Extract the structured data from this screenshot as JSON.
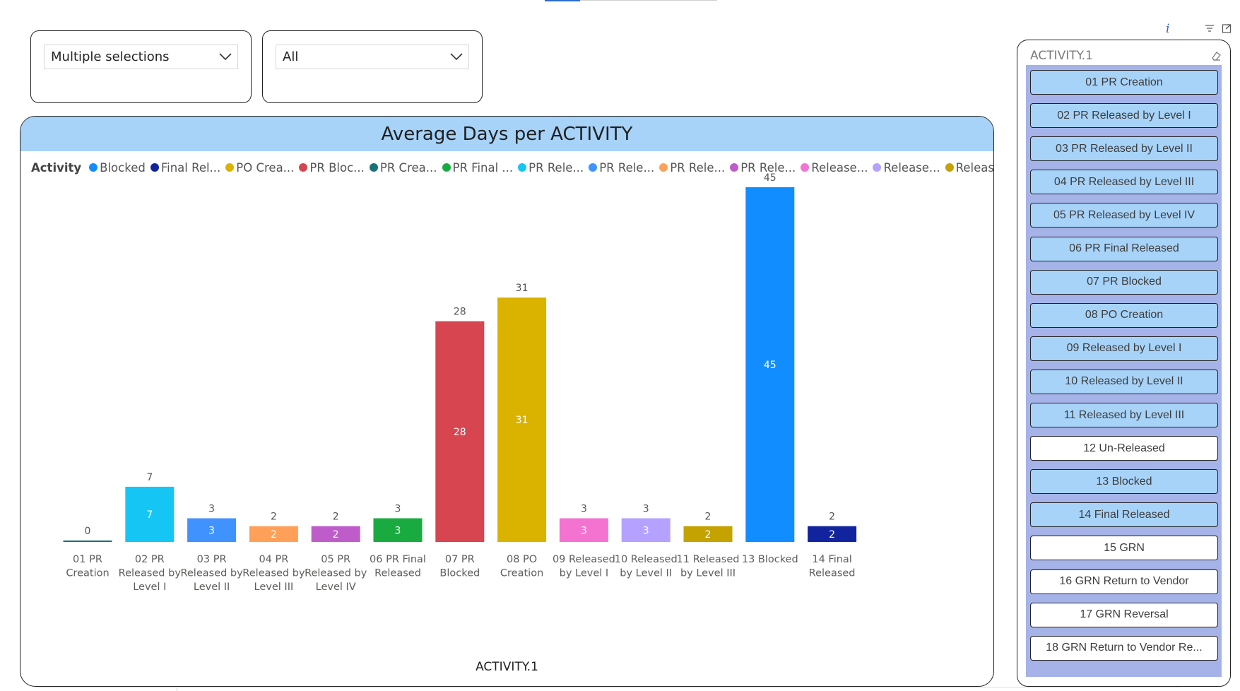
{
  "slicers": [
    {
      "value": "Multiple selections"
    },
    {
      "value": "All"
    }
  ],
  "chart_data": {
    "type": "bar",
    "title": "Average Days per ACTIVITY",
    "xlabel": "ACTIVITY.1",
    "ylabel": "",
    "legend_title": "Activity",
    "legend_placement": "top-left",
    "grid": false,
    "legend": [
      {
        "label": "Blocked",
        "color": "#118dff"
      },
      {
        "label": "Final Rel...",
        "color": "#12239e"
      },
      {
        "label": "PO Crea...",
        "color": "#d9b300"
      },
      {
        "label": "PR Bloc...",
        "color": "#d64550"
      },
      {
        "label": "PR Crea...",
        "color": "#197278"
      },
      {
        "label": "PR Final ...",
        "color": "#1aab40"
      },
      {
        "label": "PR Rele...",
        "color": "#15c6f4"
      },
      {
        "label": "PR Rele...",
        "color": "#4092ff"
      },
      {
        "label": "PR Rele...",
        "color": "#ffa058"
      },
      {
        "label": "PR Rele...",
        "color": "#be5dc9"
      },
      {
        "label": "Release...",
        "color": "#f472d0"
      },
      {
        "label": "Release...",
        "color": "#b5a1ff"
      },
      {
        "label": "Release...",
        "color": "#c4a200"
      }
    ],
    "categories": [
      [
        "01 PR",
        "Creation"
      ],
      [
        "02 PR",
        "Released by",
        "Level I"
      ],
      [
        "03 PR",
        "Released by",
        "Level II"
      ],
      [
        "04 PR",
        "Released by",
        "Level III"
      ],
      [
        "05 PR",
        "Released by",
        "Level IV"
      ],
      [
        "06 PR Final",
        "Released"
      ],
      [
        "07 PR",
        "Blocked"
      ],
      [
        "08 PO",
        "Creation"
      ],
      [
        "09 Released",
        "by Level I"
      ],
      [
        "10 Released",
        "by Level II"
      ],
      [
        "11 Released",
        "by Level III"
      ],
      [
        "13 Blocked"
      ],
      [
        "14 Final",
        "Released"
      ]
    ],
    "values": [
      0,
      7,
      3,
      2,
      2,
      3,
      28,
      31,
      3,
      3,
      2,
      45,
      2
    ],
    "colors": [
      "#197278",
      "#15c6f4",
      "#4092ff",
      "#ffa058",
      "#be5dc9",
      "#1aab40",
      "#d64550",
      "#d9b300",
      "#f472d0",
      "#b5a1ff",
      "#c4a200",
      "#118dff",
      "#12239e"
    ],
    "ylim": [
      0,
      45
    ]
  },
  "activity_slicer": {
    "header": "ACTIVITY.1",
    "items": [
      {
        "label": "01 PR Creation",
        "selected": true
      },
      {
        "label": "02 PR Released by Level I",
        "selected": true
      },
      {
        "label": "03 PR Released by Level II",
        "selected": true
      },
      {
        "label": "04 PR Released by Level III",
        "selected": true
      },
      {
        "label": "05 PR Released by Level IV",
        "selected": true
      },
      {
        "label": "06 PR Final Released",
        "selected": true
      },
      {
        "label": "07 PR Blocked",
        "selected": true
      },
      {
        "label": "08 PO Creation",
        "selected": true
      },
      {
        "label": "09 Released by Level I",
        "selected": true
      },
      {
        "label": "10 Released by Level II",
        "selected": true
      },
      {
        "label": "11 Released by Level III",
        "selected": true
      },
      {
        "label": "12 Un-Released",
        "selected": false
      },
      {
        "label": "13 Blocked",
        "selected": true
      },
      {
        "label": "14 Final Released",
        "selected": true
      },
      {
        "label": "15 GRN",
        "selected": false
      },
      {
        "label": "16 GRN Return to Vendor",
        "selected": false
      },
      {
        "label": "17 GRN Reversal",
        "selected": false
      },
      {
        "label": "18 GRN Return to Vendor Re...",
        "selected": false
      }
    ]
  },
  "icons": {
    "info": "info-icon",
    "filter": "filter-icon",
    "focus": "focus-mode-icon",
    "eraser": "eraser-icon",
    "chevron": "chevron-down-icon"
  }
}
